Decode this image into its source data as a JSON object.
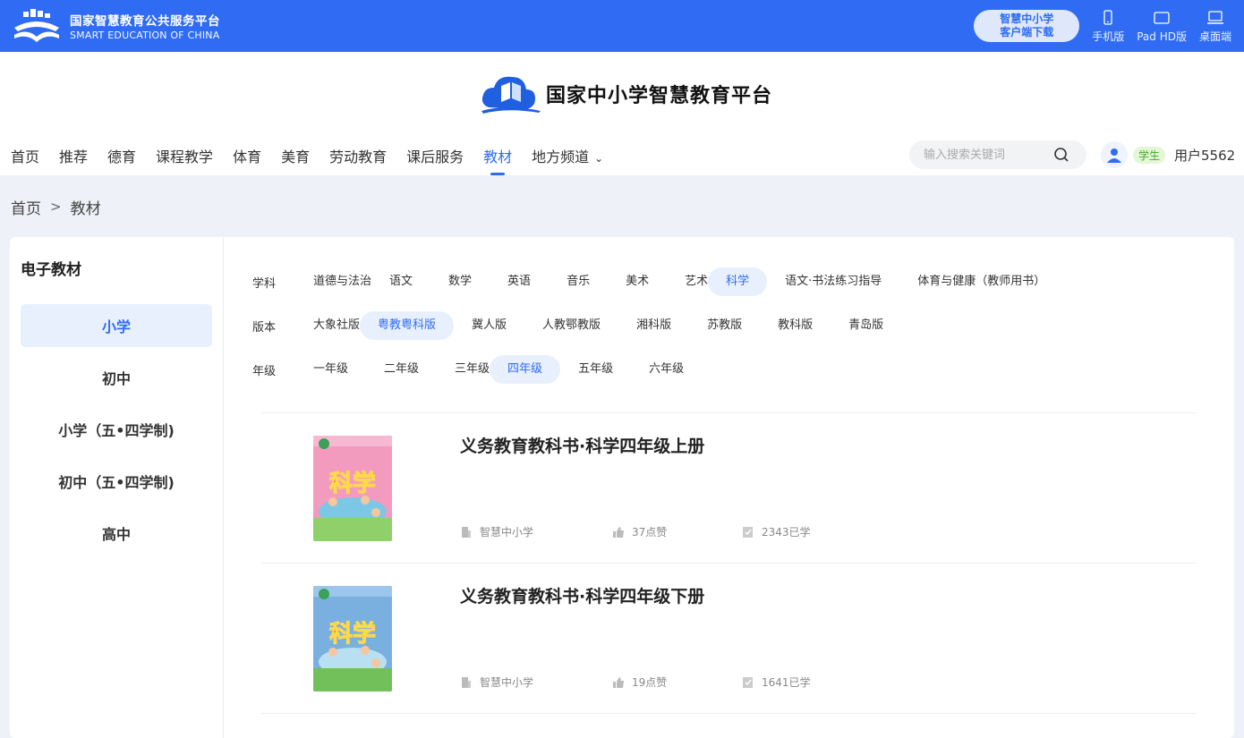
{
  "topbar": {
    "brand_cn": "国家智慧教育公共服务平台",
    "brand_en": "SMART EDUCATION OF CHINA",
    "download_line1": "智慧中小学",
    "download_line2": "客户端下载",
    "devices": [
      "手机版",
      "Pad HD版",
      "桌面端"
    ]
  },
  "header": {
    "site_title": "国家中小学智慧教育平台",
    "nav": [
      "首页",
      "推荐",
      "德育",
      "课程教学",
      "体育",
      "美育",
      "劳动教育",
      "课后服务",
      "教材",
      "地方频道"
    ],
    "active_nav": "教材",
    "search_placeholder": "输入搜索关键词",
    "role": "学生",
    "username": "用户5562"
  },
  "breadcrumb": {
    "home": "首页",
    "separator": ">",
    "current": "教材"
  },
  "sidebar": {
    "title": "电子教材",
    "items": [
      "小学",
      "初中",
      "小学（五•四学制)",
      "初中（五•四学制)",
      "高中"
    ],
    "active": "小学"
  },
  "filters": {
    "subject": {
      "label": "学科",
      "options": [
        "道德与法治",
        "语文",
        "数学",
        "英语",
        "音乐",
        "美术",
        "艺术",
        "科学",
        "语文·书法练习指导",
        "体育与健康（教师用书）"
      ],
      "active": "科学"
    },
    "edition": {
      "label": "版本",
      "options": [
        "大象社版",
        "粤教粤科版",
        "冀人版",
        "人教鄂教版",
        "湘科版",
        "苏教版",
        "教科版",
        "青岛版"
      ],
      "active": "粤教粤科版"
    },
    "grade": {
      "label": "年级",
      "options": [
        "一年级",
        "二年级",
        "三年级",
        "四年级",
        "五年级",
        "六年级"
      ],
      "active": "四年级"
    }
  },
  "books": [
    {
      "title": "义务教育教科书·科学四年级上册",
      "publisher": "智慧中小学",
      "likes": "37点赞",
      "learned": "2343已学",
      "cover_color": "#f29bbf",
      "cover_text": "科学"
    },
    {
      "title": "义务教育教科书·科学四年级下册",
      "publisher": "智慧中小学",
      "likes": "19点赞",
      "learned": "1641已学",
      "cover_color": "#7ab0e0",
      "cover_text": "科学"
    }
  ],
  "colors": {
    "accent": "#2f6cf3",
    "topbar": "#2f6cf3"
  }
}
